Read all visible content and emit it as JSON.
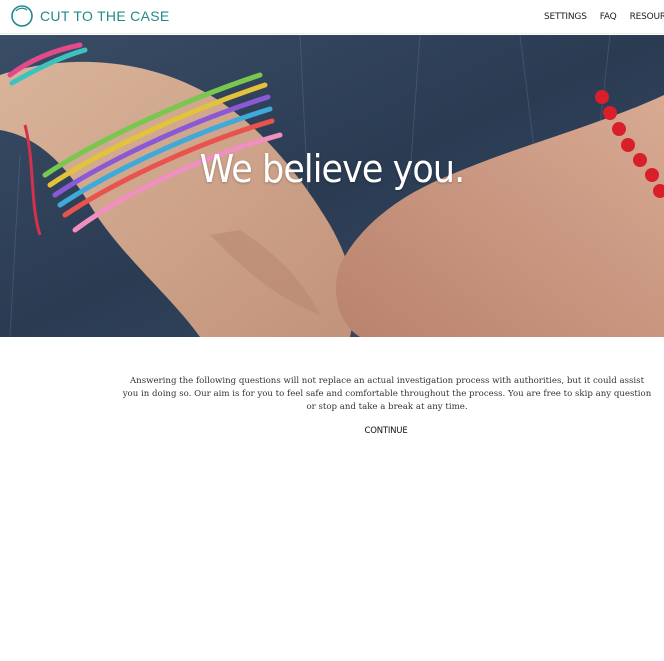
{
  "header": {
    "brand": "CUT TO THE CASE",
    "nav": [
      "SETTINGS",
      "FAQ",
      "RESOURCES"
    ]
  },
  "hero": {
    "title": "We believe you."
  },
  "intro": {
    "text": "Answering the following questions will not replace an actual investigation process with authorities, but it could assist you in doing so. Our aim is for you to feel safe and comfortable throughout the process. You are free to skip any question or stop and take a break at any time."
  },
  "actions": {
    "continue_label": "CONTINUE"
  },
  "colors": {
    "brand": "#1f8a8c",
    "hero_overlay": "#2c3e55"
  },
  "icons": {
    "logo": "circle-logo-icon"
  }
}
